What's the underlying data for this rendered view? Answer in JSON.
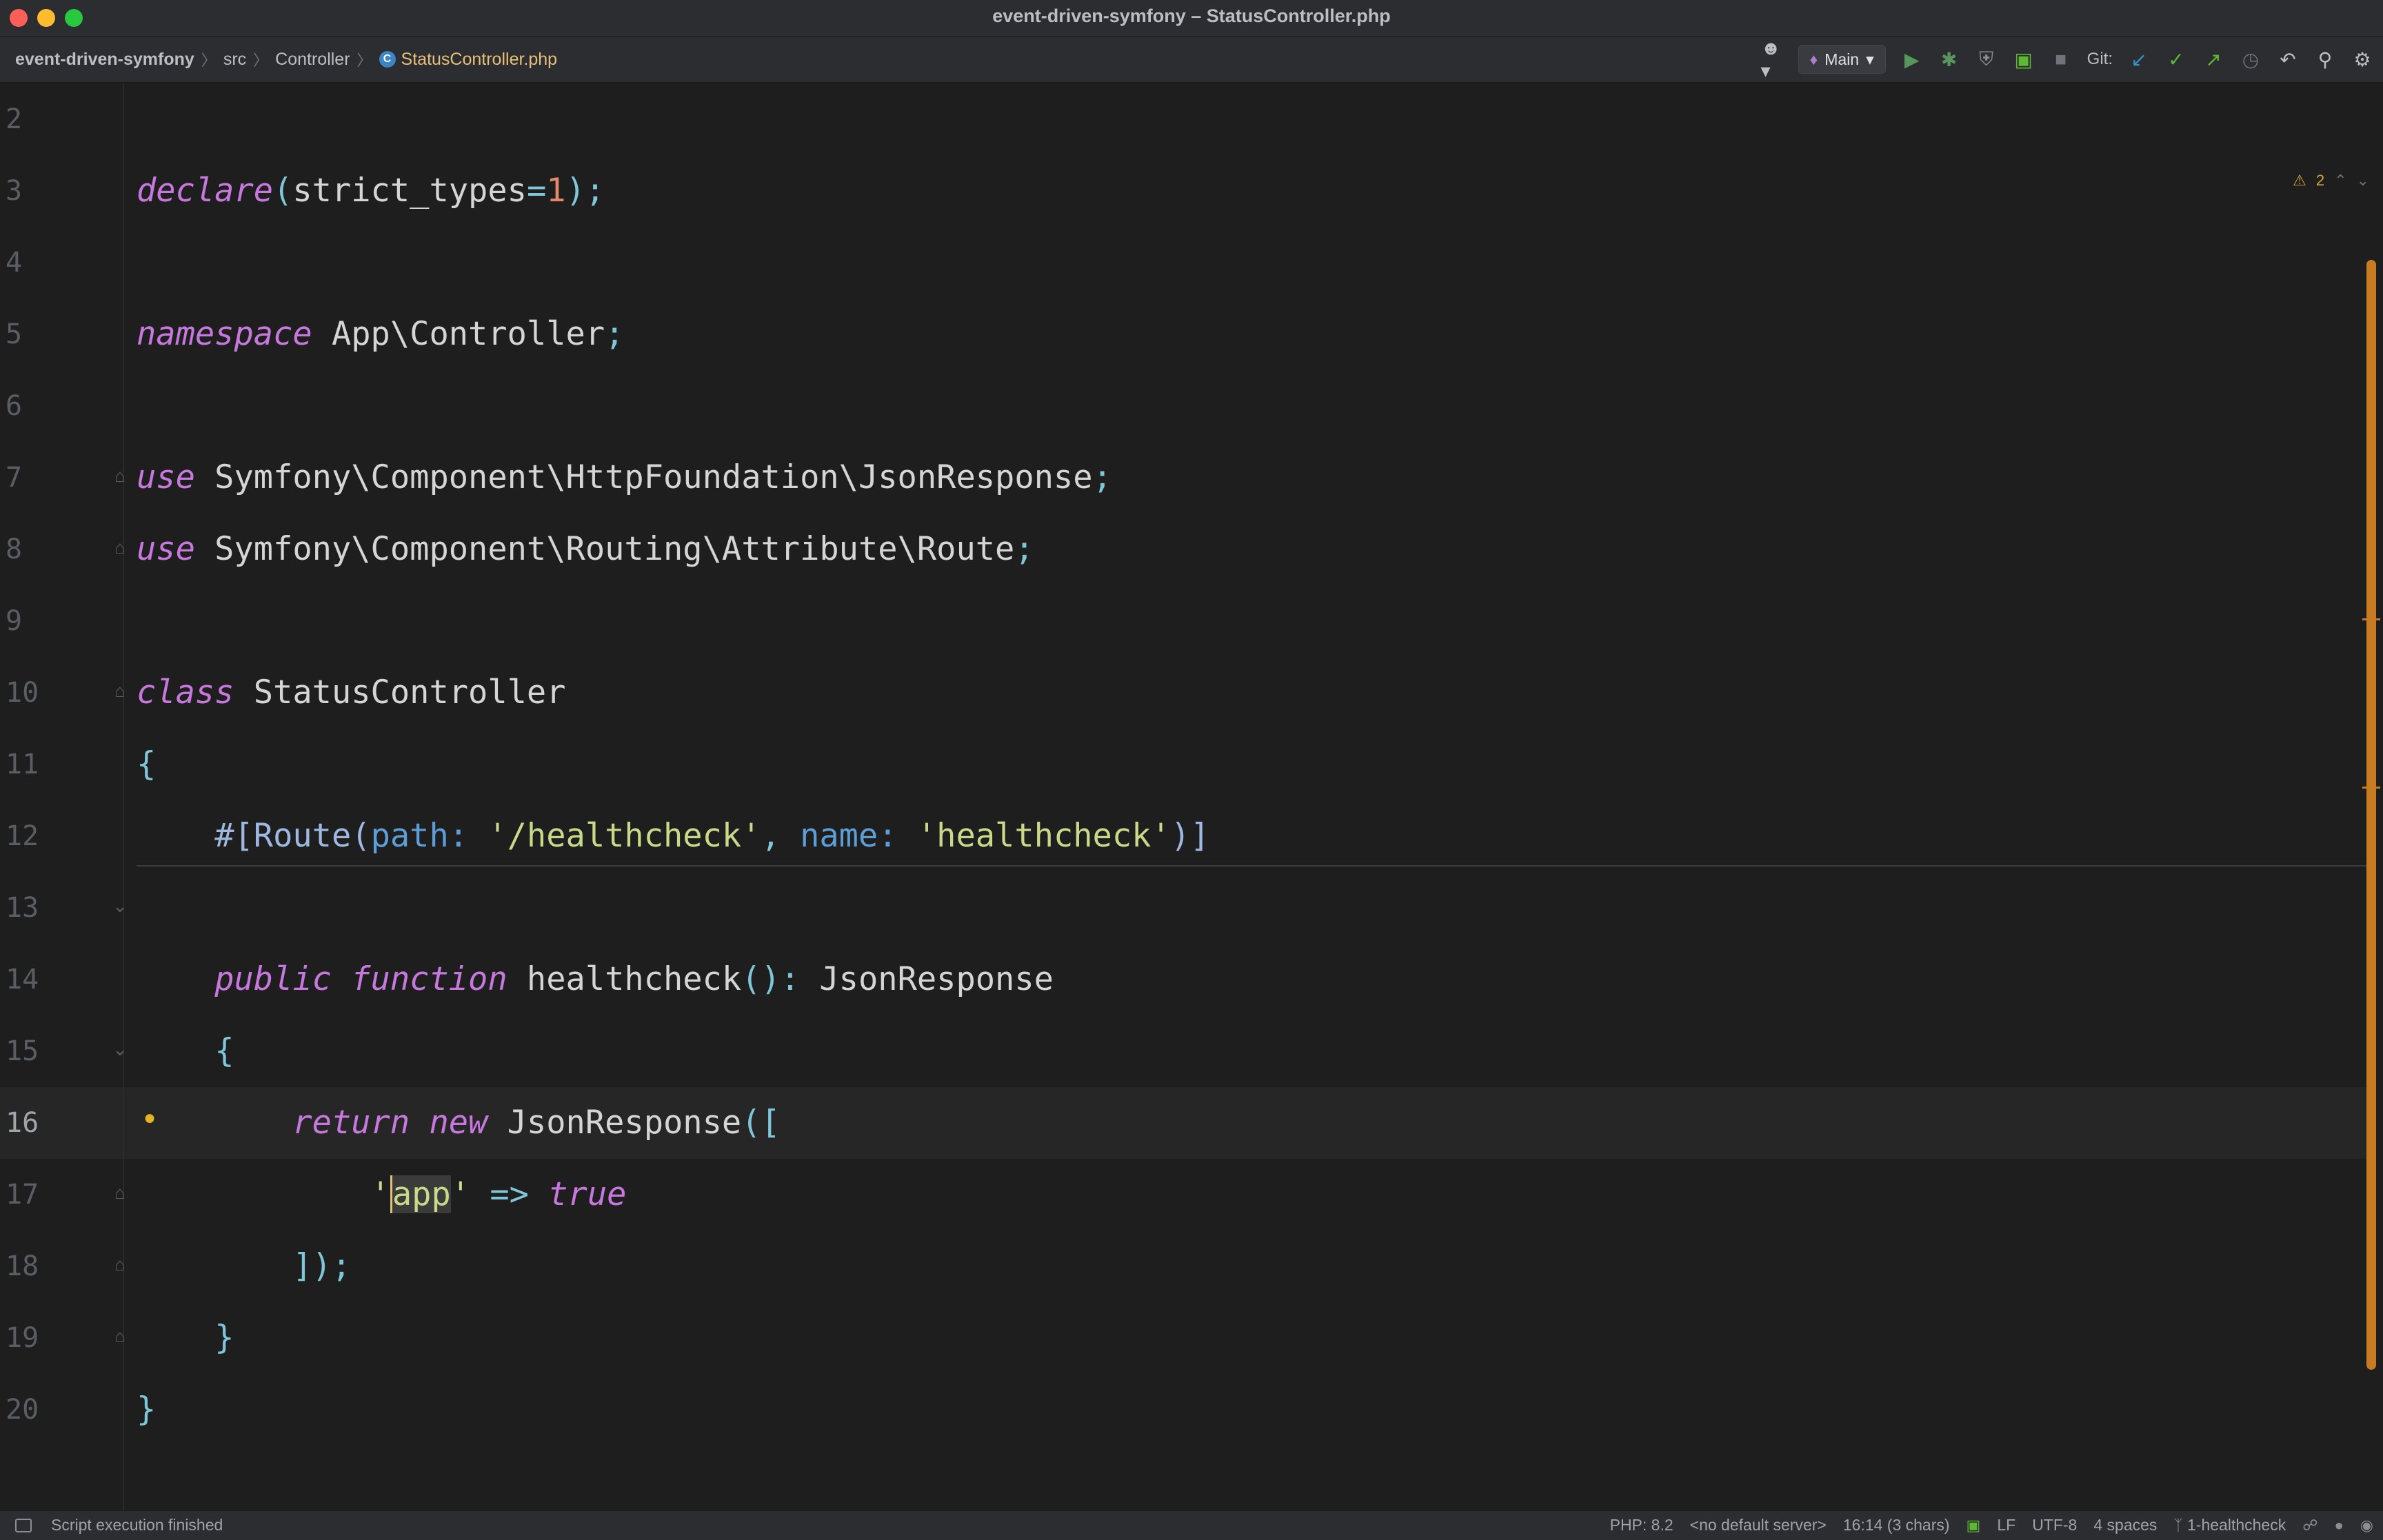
{
  "window": {
    "title": "event-driven-symfony – StatusController.php"
  },
  "breadcrumb": {
    "project": "event-driven-symfony",
    "folder1": "src",
    "folder2": "Controller",
    "file": "StatusController.php",
    "sep": "〉"
  },
  "toolbar": {
    "run_config": "Main",
    "git_label": "Git:",
    "icons": [
      "user-icon",
      "run-icon",
      "debug-icon",
      "coverage-icon",
      "profile-icon",
      "stop-icon",
      "git-update-icon",
      "git-commit-icon",
      "git-push-icon",
      "git-history-icon",
      "rollback-icon",
      "search-icon",
      "settings-icon"
    ]
  },
  "inspections": {
    "warning_count": "2"
  },
  "editor": {
    "line_numbers": [
      "2",
      "3",
      "4",
      "5",
      "6",
      "7",
      "8",
      "9",
      "10",
      "11",
      "12",
      "13",
      "14",
      "15",
      "16",
      "17",
      "18",
      "19",
      "20"
    ],
    "current_line": "16"
  },
  "status": {
    "message": "Script execution finished",
    "php_version": "PHP: 8.2",
    "server": "<no default server>",
    "position": "16:14 (3 chars)",
    "line_separator": "LF",
    "encoding": "UTF-8",
    "indent": "4 spaces",
    "branch": "1-healthcheck"
  },
  "colors": {
    "keyword": "#c678dd",
    "string": "#c9d98a",
    "number": "#e5896b",
    "punctuation": "#7fc6d8",
    "named_param": "#5d9ed6",
    "scrollbar": "#c77b23"
  }
}
